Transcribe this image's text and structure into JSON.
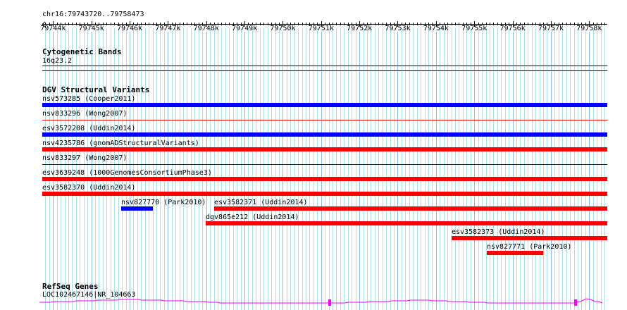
{
  "ruler": {
    "range": "chr16:79743720..79758473",
    "ticks": [
      "79744k",
      "79745k",
      "79746k",
      "79747k",
      "79748k",
      "79749k",
      "79750k",
      "79751k",
      "79752k",
      "79753k",
      "79754k",
      "79755k",
      "79756k",
      "79757k",
      "79758k"
    ]
  },
  "cytobands": {
    "title": "Cytogenetic Bands",
    "band": "16q23.2"
  },
  "dgv": {
    "title": "DGV Structural Variants",
    "items": [
      {
        "label": "nsv573285 (Cooper2011)",
        "color": "#0000ff"
      },
      {
        "label": "nsv833296 (Wong2007)",
        "color": "#ff0000"
      },
      {
        "label": "esv3572208 (Uddin2014)",
        "color": "#0000ff"
      },
      {
        "label": "nsv4235786 (gnomADStructuralVariants)",
        "color": "#ff0000"
      },
      {
        "label": "nsv833297 (Wong2007)",
        "color": "#0000ff"
      },
      {
        "label": "esv3639248 (1000GenomesConsortiumPhase3)",
        "color": "#ff0000"
      },
      {
        "label": "esv3582370 (Uddin2014)",
        "color": "#ff0000"
      },
      {
        "label": "nsv827770 (Park2010)",
        "color": "#0000ff"
      },
      {
        "label": "esv3582371 (Uddin2014)",
        "color": "#ff0000"
      },
      {
        "label": "dgv865e212 (Uddin2014)",
        "color": "#ff0000"
      },
      {
        "label": "esv3582373 (Uddin2014)",
        "color": "#ff0000"
      },
      {
        "label": "nsv827771 (Park2010)",
        "color": "#ff0000"
      }
    ]
  },
  "refseq": {
    "title": "RefSeq Genes",
    "gene": "LOC102467146|NR_104663",
    "color": "#ff00ff"
  }
}
